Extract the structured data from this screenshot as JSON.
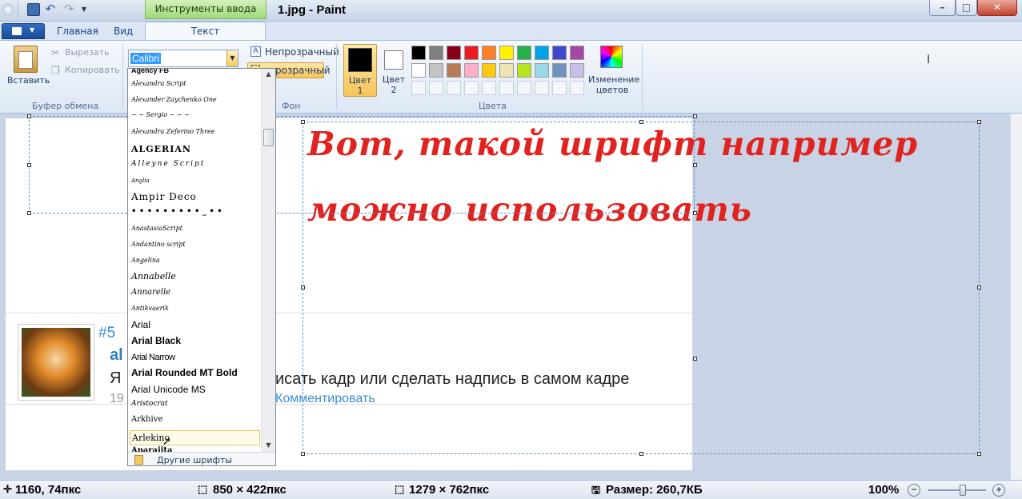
{
  "window": {
    "title": "1.jpg - Paint",
    "contextual_tab": "Инструменты ввода текста"
  },
  "tabs": {
    "home": "Главная",
    "view": "Вид",
    "text": "Текст"
  },
  "clipboard": {
    "paste": "Вставить",
    "cut": "Вырезать",
    "copy": "Копировать",
    "group": "Буфер обмена"
  },
  "background": {
    "opaque": "Непрозрачный",
    "transparent": "розрачный",
    "group": "Фон"
  },
  "colors": {
    "color1_label": "Цвет",
    "color1_num": "1",
    "color2_label": "Цвет",
    "color2_num": "2",
    "edit_line1": "Изменение",
    "edit_line2": "цветов",
    "group": "Цвета",
    "color1": "#000000",
    "color2": "#ffffff",
    "row1": [
      "#000000",
      "#7f7f7f",
      "#880015",
      "#ed1c24",
      "#ff7f27",
      "#fff200",
      "#22b14c",
      "#00a2e8",
      "#3f48cc",
      "#a349a4"
    ],
    "row2": [
      "#ffffff",
      "#c3c3c3",
      "#b97a57",
      "#ffaec9",
      "#ffc90e",
      "#efe4b0",
      "#b5e61d",
      "#99d9ea",
      "#7092be",
      "#c8bfe7"
    ]
  },
  "font_picker": {
    "current_font": "Calibri",
    "fonts": [
      "Agency FB",
      "Alexandra Script",
      "Alexander Zaychenko One",
      "~ ~ Sergio ~ ~ ~",
      "Alexandra Zeferino Three",
      "ALGERIAN",
      "Alleyne Script",
      "Anglia",
      "Ampir Deco",
      "• • • • • • • • • _ • •",
      "AnastasiaScript",
      "Andantino script",
      "Angelina",
      "Annabelle",
      "Annarelle",
      "Antikvaerik",
      "Arial",
      "Arial Black",
      "Arial Narrow",
      "Arial Rounded MT Bold",
      "Arial Unicode MS",
      "Aristocrat",
      "Arkhive",
      "Arlekino",
      "Aparajita"
    ],
    "more_fonts": "Другие шрифты"
  },
  "canvas": {
    "art_line1": "Вот, такой шрифт например",
    "art_line2": "можно использовать",
    "post_number": "#5",
    "post_author": "al",
    "post_body_prefix": "Я",
    "post_body": "исать кадр или сделать надпись в самом кадре",
    "post_date": "19",
    "comment_link": "Комментировать"
  },
  "status": {
    "cursor": "1160, 74пкс",
    "selection": "850 × 422пкс",
    "image_size": "1279 × 762пкс",
    "file_size": "Размер: 260,7КБ",
    "zoom": "100%"
  }
}
